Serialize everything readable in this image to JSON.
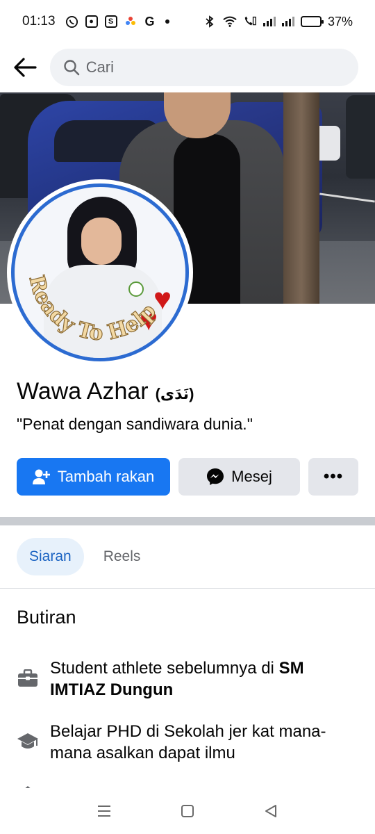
{
  "status_bar": {
    "time": "01:13",
    "battery_percent": "37%",
    "battery_level": 0.37,
    "icons": [
      "whatsapp-icon",
      "app-icon",
      "shopee-icon",
      "photos-icon",
      "google-icon",
      "bluetooth-icon",
      "wifi-icon",
      "volte-icon",
      "signal-icon"
    ]
  },
  "header": {
    "search_placeholder": "Cari"
  },
  "profile": {
    "name": "Wawa Azhar",
    "alt_name": "(نَدَى)",
    "bio": "\"Penat dengan sandiwara dunia.\"",
    "avatar_caption": "Ready To Help"
  },
  "actions": {
    "add_friend": "Tambah rakan",
    "message": "Mesej",
    "more": "•••"
  },
  "tabs": [
    {
      "label": "Siaran",
      "active": true
    },
    {
      "label": "Reels",
      "active": false
    }
  ],
  "details": {
    "title": "Butiran",
    "items": [
      {
        "icon": "briefcase-icon",
        "text_prefix": "Student athlete sebelumnya di ",
        "text_bold": "SM IMTIAZ Dungun"
      },
      {
        "icon": "graduation-cap-icon",
        "text": "Belajar PHD di Sekolah jer kat mana-mana asalkan dapat ilmu"
      }
    ]
  },
  "colors": {
    "primary": "#1877f2",
    "secondary_bg": "#e4e6eb",
    "tab_active_bg": "#e7f1fb",
    "tab_active_text": "#1b63c2"
  }
}
